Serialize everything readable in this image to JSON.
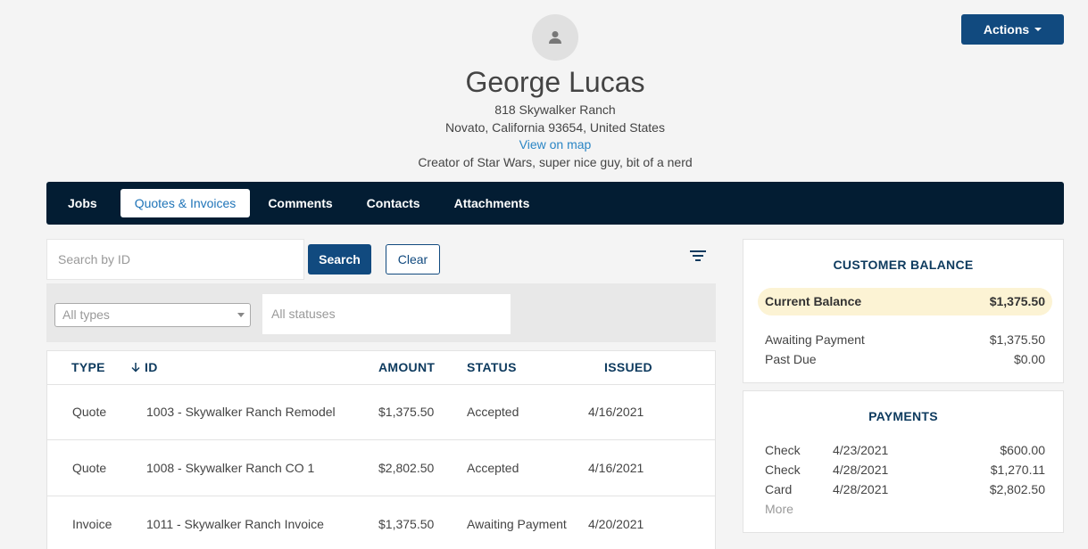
{
  "header": {
    "name": "George Lucas",
    "address1": "818 Skywalker Ranch",
    "address2": "Novato, California 93654, United States",
    "map_link": "View on map",
    "description": "Creator of Star Wars, super nice guy, bit of a nerd",
    "actions_label": "Actions"
  },
  "tabs": [
    {
      "label": "Jobs"
    },
    {
      "label": "Quotes & Invoices"
    },
    {
      "label": "Comments"
    },
    {
      "label": "Contacts"
    },
    {
      "label": "Attachments"
    }
  ],
  "search": {
    "placeholder": "Search by ID",
    "value": "",
    "search_label": "Search",
    "clear_label": "Clear"
  },
  "filters": {
    "type_selected": "All types",
    "status_placeholder": "All statuses"
  },
  "table": {
    "columns": {
      "type": "TYPE",
      "id": "ID",
      "amount": "AMOUNT",
      "status": "STATUS",
      "issued": "ISSUED"
    },
    "rows": [
      {
        "type": "Quote",
        "id": "1003 - Skywalker Ranch Remodel",
        "amount": "$1,375.50",
        "status": "Accepted",
        "issued": "4/16/2021"
      },
      {
        "type": "Quote",
        "id": "1008 - Skywalker Ranch CO 1",
        "amount": "$2,802.50",
        "status": "Accepted",
        "issued": "4/16/2021"
      },
      {
        "type": "Invoice",
        "id": "1011 - Skywalker Ranch Invoice",
        "amount": "$1,375.50",
        "status": "Awaiting Payment",
        "issued": "4/20/2021"
      }
    ]
  },
  "balance": {
    "title": "CUSTOMER BALANCE",
    "current_label": "Current Balance",
    "current_value": "$1,375.50",
    "awaiting_label": "Awaiting Payment",
    "awaiting_value": "$1,375.50",
    "past_due_label": "Past Due",
    "past_due_value": "$0.00"
  },
  "payments": {
    "title": "PAYMENTS",
    "items": [
      {
        "method": "Check",
        "date": "4/23/2021",
        "amount": "$600.00"
      },
      {
        "method": "Check",
        "date": "4/28/2021",
        "amount": "$1,270.11"
      },
      {
        "method": "Card",
        "date": "4/28/2021",
        "amount": "$2,802.50"
      }
    ],
    "more_label": "More"
  },
  "colors": {
    "primary": "#114a7f",
    "nav_bg": "#031d33",
    "link": "#2b86c5",
    "highlight": "#fcf3d4"
  }
}
